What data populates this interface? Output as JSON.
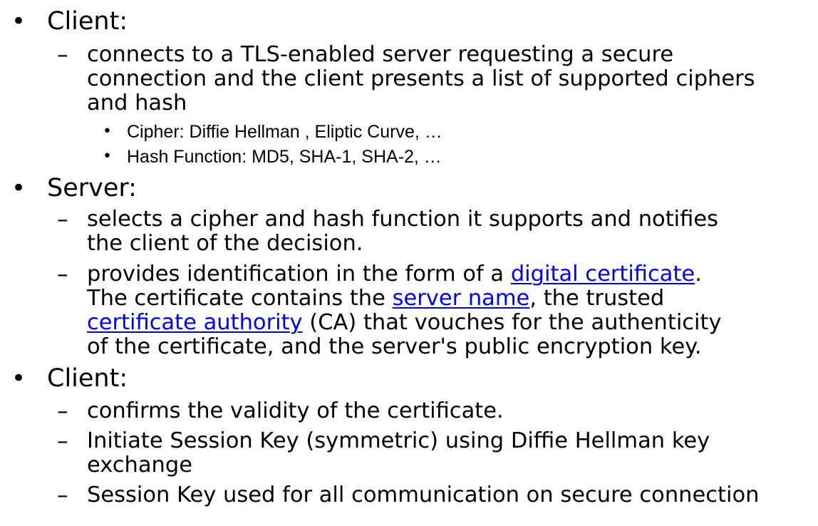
{
  "colors": {
    "text": "#000000",
    "link": "#0000ee",
    "background": "#ffffff"
  },
  "markers": {
    "level1": "•",
    "level2": "–",
    "level3": "•"
  },
  "section1": {
    "heading": "Client:",
    "item1": {
      "line1": "connects to a TLS-enabled server requesting a secure",
      "line2": "connection and the client presents a list of supported ciphers",
      "line3": "and hash"
    },
    "sub1": "Cipher:   Diffie Hellman , Eliptic Curve, …",
    "sub2": "Hash Function: MD5, SHA-1, SHA-2, …"
  },
  "section2": {
    "heading": "Server:",
    "item1": {
      "line1": "selects a cipher and hash function it supports and notifies",
      "line2": "the client of the decision."
    },
    "item2": {
      "line1_pre": "provides identification in the form of a ",
      "link_digital_certificate": "digital certificate",
      "line1_post": ".",
      "line2_pre": "The certificate contains the ",
      "link_server_name": "server name",
      "line2_post": ", the trusted",
      "link_certificate_authority": "certificate authority",
      "line3_post": " (CA) that vouches for the authenticity",
      "line4": "of the certificate, and the server's public encryption key."
    }
  },
  "section3": {
    "heading": "Client:",
    "item1": "confirms the validity of the certificate.",
    "item2": {
      "line1": "Initiate Session Key (symmetric) using Diffie Hellman key",
      "line2": "exchange"
    },
    "item3": "Session Key used for all communication on secure connection"
  }
}
